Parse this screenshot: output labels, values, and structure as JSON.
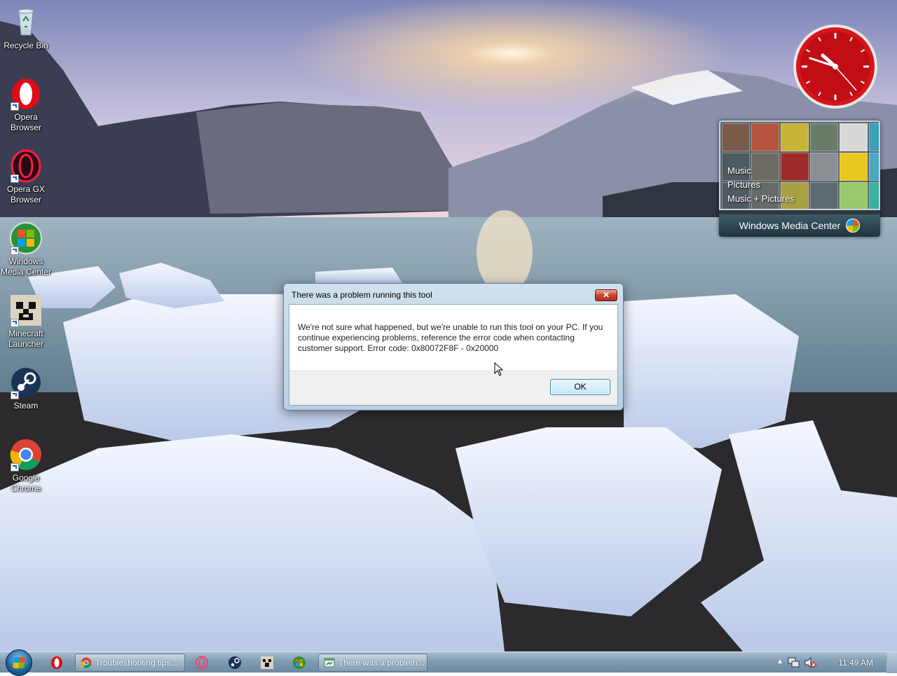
{
  "desktop": {
    "icons": [
      {
        "label": "Recycle Bin",
        "icon": "recycle-bin-icon"
      },
      {
        "label": "Opera Browser",
        "icon": "opera-icon"
      },
      {
        "label": "Opera GX Browser",
        "icon": "opera-gx-icon"
      },
      {
        "label": "Windows Media Center",
        "icon": "windows-media-center-icon"
      },
      {
        "label": "Minecraft Launcher",
        "icon": "minecraft-icon"
      },
      {
        "label": "Steam",
        "icon": "steam-icon"
      },
      {
        "label": "Google Chrome",
        "icon": "chrome-icon"
      }
    ]
  },
  "gadgets": {
    "clock": {
      "color": "#d8151b",
      "time": "11:49"
    },
    "media_center": {
      "menu": [
        "Music",
        "Pictures",
        "Music + Pictures"
      ],
      "title": "Windows Media Center"
    }
  },
  "dialog": {
    "title": "There was a problem running this tool",
    "close_label": "✕",
    "message": "We're not sure what happened, but we're unable to run this tool on your PC. If you continue experiencing problems, reference the error code when contacting customer support. Error code: 0x80072F8F - 0x20000",
    "ok_label": "OK"
  },
  "taskbar": {
    "quick_launch": [
      "opera-icon",
      "opera-gx-icon",
      "steam-icon",
      "minecraft-icon",
      "windows-media-center-icon"
    ],
    "buttons": [
      {
        "label": "Troubleshooting tips...",
        "icon": "chrome-icon"
      },
      {
        "label": "There was a problem...",
        "icon": "tool-icon"
      }
    ],
    "tray": {
      "time": "11:49 AM"
    }
  }
}
